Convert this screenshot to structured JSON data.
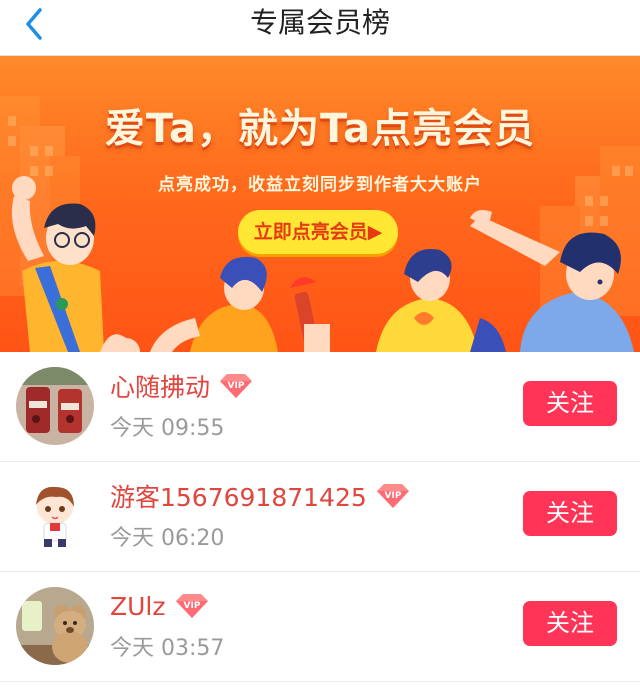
{
  "nav": {
    "title": "专属会员榜",
    "back_icon": "chevron-left-icon"
  },
  "banner": {
    "title": "爱Ta，就为Ta点亮会员",
    "subtitle": "点亮成功，收益立刻同步到作者大大账户",
    "button_label": "立即点亮会员▶"
  },
  "members": [
    {
      "name": "心随拂动",
      "time": "今天 09:55",
      "badge": "VIP",
      "follow_label": "关注"
    },
    {
      "name": "游客1567691871425",
      "time": "今天 06:20",
      "badge": "VIP",
      "follow_label": "关注"
    },
    {
      "name": "ZUlz",
      "time": "今天 03:57",
      "badge": "VIP",
      "follow_label": "关注"
    }
  ],
  "colors": {
    "accent": "#ff3456",
    "name": "#e0453e",
    "banner_orange": "#ff6a1c",
    "banner_button": "#ffe733"
  }
}
